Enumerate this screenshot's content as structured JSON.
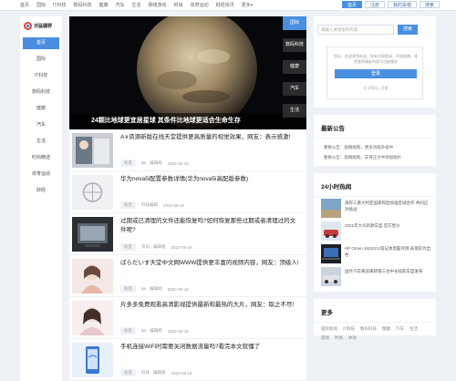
{
  "topnav": [
    "首页",
    "国际",
    "IT科技",
    "数码科技",
    "健康",
    "汽车",
    "生活",
    "网络游戏",
    "时尚",
    "体育运动",
    "财经资讯",
    "更多▾"
  ],
  "topbtns": [
    "首页",
    "注册",
    "我的投稿",
    "搜索"
  ],
  "logo": {
    "text": "泺猛疆野"
  },
  "categories": [
    "首页",
    "国际",
    "IT科技",
    "数码科技",
    "健康",
    "汽车",
    "生活",
    "时尚精选",
    "体育运动",
    "财经"
  ],
  "banner": {
    "caption": "24颗比地球更宜居星球  其条件比地球更适合生命生存",
    "tabs": [
      "国际",
      "数码科技",
      "健康",
      "汽车",
      "生活"
    ]
  },
  "articles": [
    {
      "title": "A∨资源新版在线天堂提供更高质量的视觉效果，网友：表示感激!",
      "tag": "标签",
      "author": "ljw · 编辑组",
      "date": "2022-05-19"
    },
    {
      "title": "华为nova5i配置参数详情(华为nova5i高配版参数)",
      "tag": "标签",
      "author": "科技编辑",
      "date": "2022-05-19"
    },
    {
      "title": "过期或已清理的文件还能恢复吗?如何恢复那些过期或者清理过的文件呢?",
      "tag": "标签",
      "author": "资讯 · 编辑组",
      "date": "2022-05-19"
    },
    {
      "title": "ばらだいす天堂中文网WWW提供更丰富的视频内容，网友：顶级人!",
      "tag": "标签",
      "author": "ljw · 编辑组",
      "date": "2022-05-18"
    },
    {
      "title": "片多多免费观看高清影视提供最新和最热的大片，网友：取之不尽!",
      "tag": "标签",
      "author": "ljw · 编辑组",
      "date": "2022-05-18"
    },
    {
      "title": "手机连接WiFi时需要关闭数据流量吗?看完本文就懂了",
      "tag": "标签",
      "author": "科技 · 编辑组",
      "date": "2022-05-18"
    }
  ],
  "search": {
    "placeholder": "请输入要搜索的内容",
    "button": "搜索"
  },
  "login": {
    "tip": "您好，欢迎来到本站，快来注册登录，开始投稿，体验更多精彩内容与功能服务",
    "button": "登录",
    "links": "忘记密码  |  注册"
  },
  "notice": {
    "title": "最新公告",
    "items": [
      "· 重要公告：投稿规则，更多功能升级中",
      "· 重要公告：投稿规则，支持正文中添加图片"
    ]
  },
  "hot": {
    "title": "24小时热闻",
    "items": [
      "海岸三重大利亚国家和团加强区域合作 共同应对挑战",
      "2021年大众新款车型 官方售价",
      "HP Omen 16(2021)笔记本电脑评测 表现较为出色",
      "国外汽车将迎来新增三台中长续航车型发布"
    ]
  },
  "more": {
    "title": "更多",
    "links": [
      "国际新闻",
      "IT科技",
      "数码科技",
      "健康",
      "汽车",
      "生活",
      "游戏",
      "时尚",
      "体育"
    ]
  }
}
